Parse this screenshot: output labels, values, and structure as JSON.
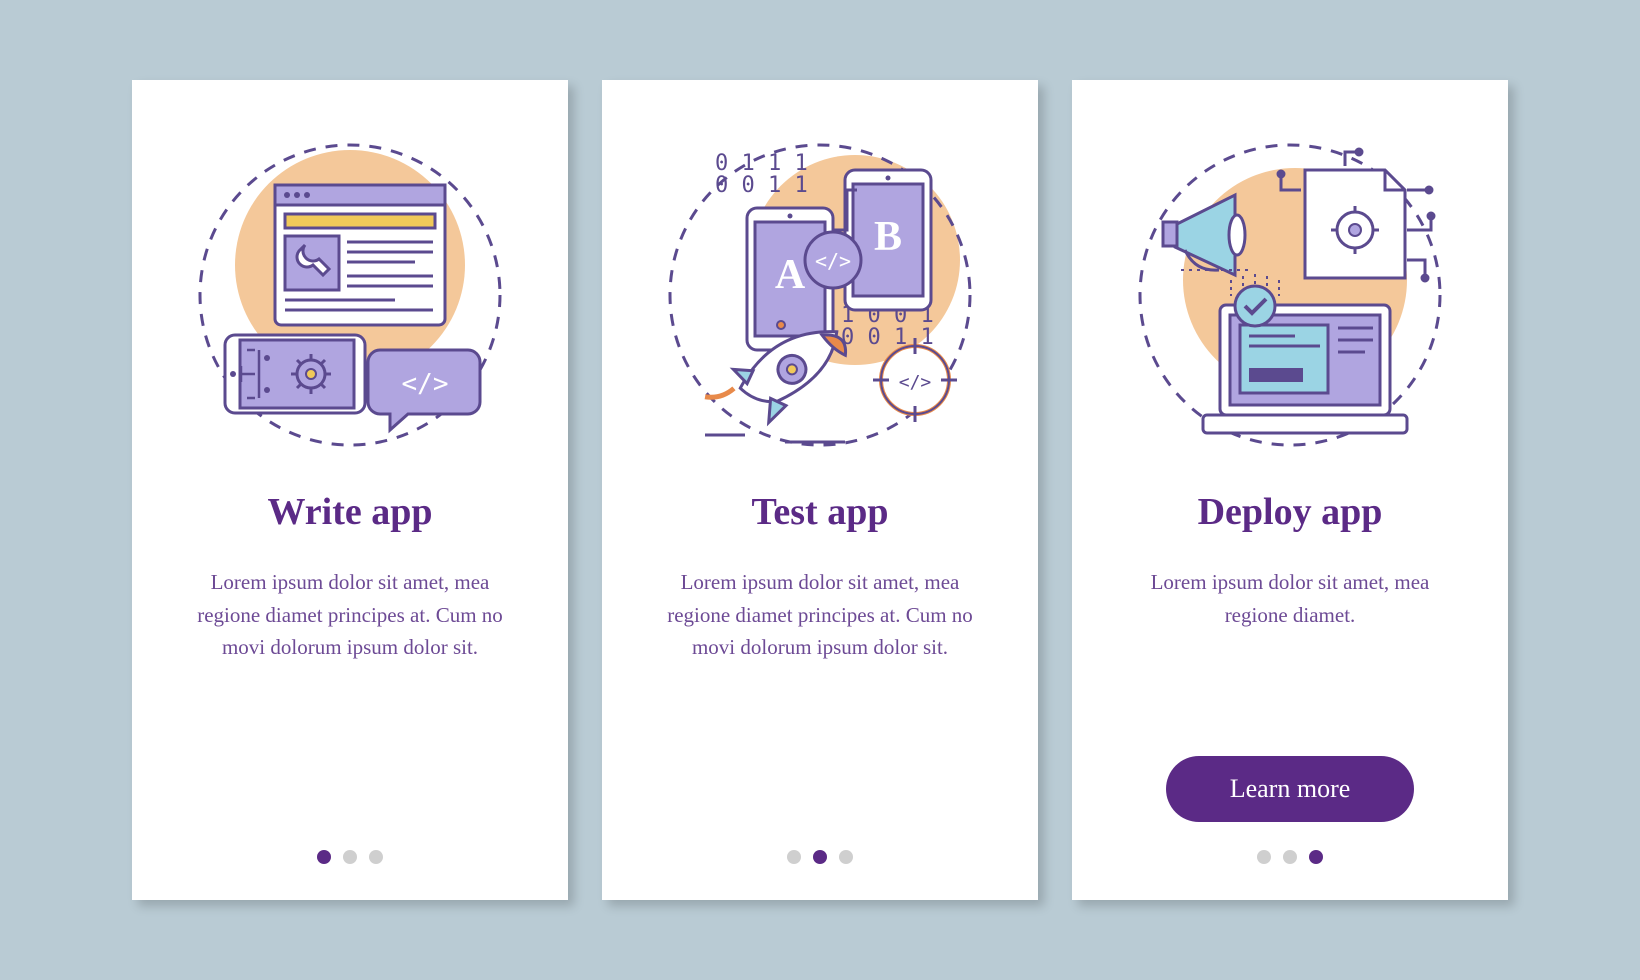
{
  "cards": [
    {
      "title": "Write app",
      "desc": "Lorem ipsum dolor sit amet, mea regione diamet principes at. Cum no movi dolorum ipsum dolor sit.",
      "activeDot": 0
    },
    {
      "title": "Test app",
      "desc": "Lorem ipsum dolor sit amet, mea regione diamet principes at. Cum no movi dolorum ipsum dolor sit.",
      "activeDot": 1
    },
    {
      "title": "Deploy app",
      "desc": "Lorem ipsum dolor sit amet, mea regione diamet.",
      "activeDot": 2,
      "cta": "Learn more"
    }
  ],
  "colors": {
    "accent": "#5b2a86",
    "peach": "#f4c89a",
    "line": "#5b4a8f",
    "blue": "#9bd4e4",
    "lilac": "#b0a5e0",
    "inactive": "#cfcfcf",
    "yellow": "#f0c95a",
    "orange": "#e88a4a"
  }
}
